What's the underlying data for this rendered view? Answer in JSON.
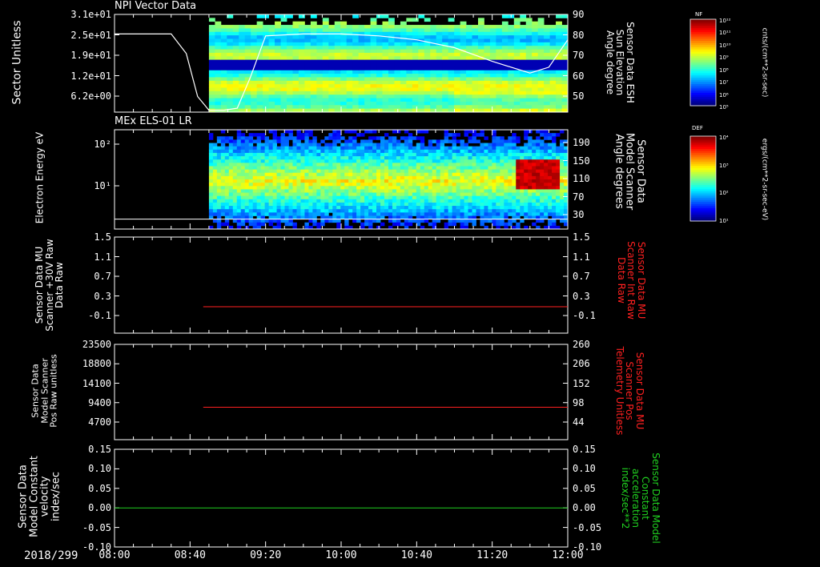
{
  "x_axis": {
    "date": "2018/299",
    "ticks": [
      "08:00",
      "08:40",
      "09:20",
      "10:00",
      "10:40",
      "11:20",
      "12:00"
    ]
  },
  "colors": {
    "model_red": "#ff2020",
    "model_green": "#20d020",
    "axis": "#ffffff"
  },
  "chart_data": [
    {
      "type": "heatmap",
      "title": "NPI Vector Data",
      "ylabel": "Sector Unitless",
      "y_ticks": [
        "3.1e+01",
        "2.5e+01",
        "1.9e+01",
        "1.2e+01",
        "6.2e+00"
      ],
      "y2label": "Sensor Data ESH Sun Elevation Angle degree",
      "y2_ticks": [
        "90",
        "80",
        "70",
        "60",
        "50"
      ],
      "y2_range": [
        40,
        90
      ],
      "data_start": "08:50",
      "colorbar": {
        "label": "cnts/(cm**2-sr-sec)",
        "title": "NF",
        "ticks": [
          "10¹²",
          "10¹¹",
          "10¹⁰",
          "10⁹",
          "10⁸",
          "10⁷",
          "10⁶",
          "10⁵"
        ]
      },
      "overlay_line": {
        "name": "Sensor Data ESH Sun Elevation Angle",
        "x": [
          "08:00",
          "08:30",
          "08:38",
          "08:44",
          "08:50",
          "08:58",
          "09:05",
          "09:12",
          "09:20",
          "09:40",
          "10:00",
          "10:20",
          "10:40",
          "11:00",
          "11:20",
          "11:40",
          "11:50",
          "12:00"
        ],
        "y": [
          80,
          80,
          70,
          48,
          41,
          41,
          42,
          58,
          79,
          80,
          80,
          79,
          77,
          73,
          66,
          60,
          63,
          77
        ]
      }
    },
    {
      "type": "heatmap",
      "title": "MEx ELS-01 LR",
      "ylabel": "Electron Energy eV",
      "y_ticks": [
        "10²",
        "10¹"
      ],
      "y2label": "Sensor Data Model Scanner Angle degrees",
      "y2_ticks": [
        "190",
        "150",
        "110",
        "70",
        "30"
      ],
      "y2_range": [
        -10,
        190
      ],
      "data_start": "08:50",
      "colorbar": {
        "label": "ergs/(cm**2-sr-sec-eV)",
        "title": "DEF",
        "ticks": [
          "10⁴",
          "10³",
          "10²",
          "10¹"
        ]
      },
      "overlay_line": {
        "name": "Sensor Data Model Scanner Angle",
        "x": [
          "08:00",
          "12:00"
        ],
        "y": [
          10,
          10
        ]
      }
    },
    {
      "type": "line",
      "ylabel": "Sensor Data MU Scanner +30V Raw Data Raw",
      "y_ticks": [
        "1.5",
        "1.1",
        "0.7",
        "0.3",
        "-0.1"
      ],
      "ylim": [
        -0.5,
        1.5
      ],
      "y2label": "Sensor Data MU Scanner Int Raw Data Raw",
      "y2_ticks": [
        "1.5",
        "1.1",
        "0.7",
        "0.3",
        "-0.1"
      ],
      "series": [
        {
          "name": "Sensor Data MU Scanner Int Raw Data",
          "color": "#ff2020",
          "x": [
            "08:47",
            "12:00"
          ],
          "y": [
            0.05,
            0.05
          ]
        }
      ]
    },
    {
      "type": "line",
      "ylabel": "Sensor Data Model Scanner Pos Raw unitless",
      "y_ticks": [
        "23500",
        "18800",
        "14100",
        "9400",
        "4700"
      ],
      "ylim": [
        0,
        23500
      ],
      "y2label": "Sensor Data MU Scanner Pos Telemetry Unitless",
      "y2_ticks": [
        "260",
        "206",
        "152",
        "98",
        "44"
      ],
      "series": [
        {
          "name": "Sensor Data MU Scanner Pos Telemetry",
          "color": "#ff2020",
          "x": [
            "08:47",
            "12:00"
          ],
          "y": [
            8000,
            8000
          ]
        }
      ]
    },
    {
      "type": "line",
      "ylabel": "Sensor Data Model Constant velocity index/sec",
      "y_ticks": [
        "0.15",
        "0.10",
        "0.05",
        "0.00",
        "-0.05",
        "-0.10"
      ],
      "ylim": [
        -0.1,
        0.15
      ],
      "y2label": "Sensor Data Model Constant acceleration index/sec**2",
      "y2_ticks": [
        "0.15",
        "0.10",
        "0.05",
        "0.00",
        "-0.05",
        "-0.10"
      ],
      "series": [
        {
          "name": "Sensor Data Model Constant acceleration",
          "color": "#20d020",
          "x": [
            "08:00",
            "12:00"
          ],
          "y": [
            0.0,
            0.0
          ]
        }
      ]
    }
  ]
}
